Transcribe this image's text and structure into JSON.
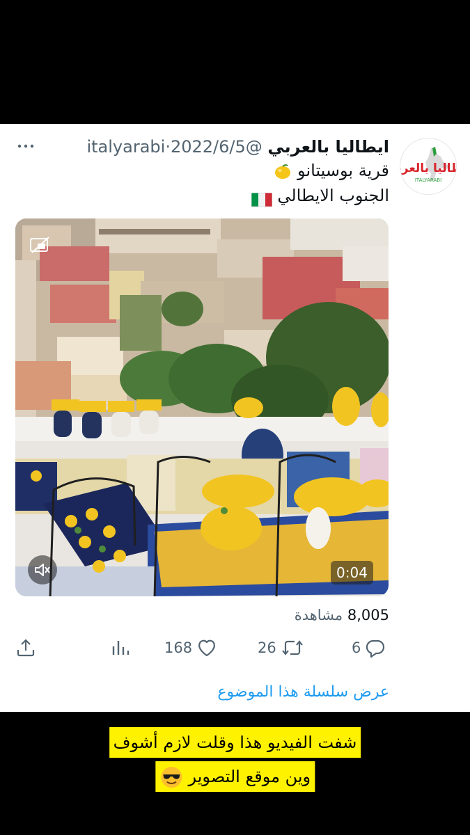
{
  "tweet": {
    "author_name": "ايطاليا بالعربي",
    "handle": "@italyarabi",
    "separator": "·",
    "date": "2022/6/5",
    "line1_text": "قرية بوسيتانو",
    "line1_emoji": "lemon-emoji",
    "line2_text": "الجنوب الايطالي",
    "line2_emoji": "italy-flag-emoji",
    "avatar_text": "ايطاليا بالعربي",
    "avatar_subtext": "ITALYARABI",
    "more_icon": "more-horizontal-icon"
  },
  "media": {
    "duration": "0:04",
    "mute_icon": "speaker-muted-icon",
    "pip_icon": "picture-in-picture-icon"
  },
  "stats": {
    "views_count": "8,005",
    "views_label": "مشاهدة"
  },
  "actions": {
    "replies": "6",
    "retweets": "26",
    "likes": "168",
    "analytics_icon": "analytics-icon",
    "share_icon": "share-icon"
  },
  "thread_link": "عرض سلسلة هذا الموضوع",
  "caption": {
    "line1": "شفت الفيديو هذا وقلت لازم أشوف",
    "line2": "وين موقع التصوير",
    "emoji": "sunglasses-emoji"
  },
  "colors": {
    "link_blue": "#1d9bf0",
    "muted_gray": "#536471",
    "caption_yellow": "#fff200"
  }
}
